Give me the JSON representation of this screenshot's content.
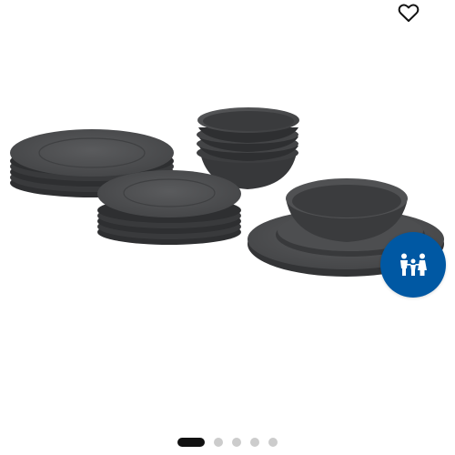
{
  "colors": {
    "accent": "#0058a3",
    "dish": "#4a4b4d",
    "dish_dark": "#2f3032",
    "dish_light": "#5e5f61",
    "dot_active": "#111111",
    "dot_inactive": "#cccccc",
    "icon": "#111111"
  },
  "icons": {
    "favorite": "heart-icon",
    "kids": "family-icon"
  },
  "carousel": {
    "slide_count": 5,
    "active_index": 0
  }
}
